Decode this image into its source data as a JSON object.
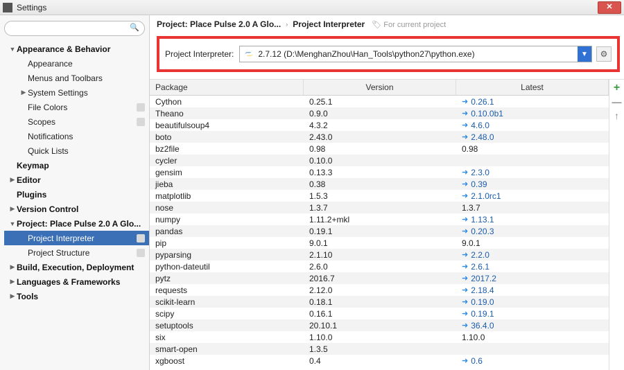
{
  "window": {
    "title": "Settings"
  },
  "sidebar": {
    "search_placeholder": "",
    "items": [
      {
        "label": "Appearance & Behavior",
        "indent": 0,
        "chev": "down",
        "bold": true
      },
      {
        "label": "Appearance",
        "indent": 1
      },
      {
        "label": "Menus and Toolbars",
        "indent": 1
      },
      {
        "label": "System Settings",
        "indent": 1,
        "chev": "right"
      },
      {
        "label": "File Colors",
        "indent": 1,
        "badge": true
      },
      {
        "label": "Scopes",
        "indent": 1,
        "badge": true
      },
      {
        "label": "Notifications",
        "indent": 1
      },
      {
        "label": "Quick Lists",
        "indent": 1
      },
      {
        "label": "Keymap",
        "indent": 0,
        "bold": true
      },
      {
        "label": "Editor",
        "indent": 0,
        "chev": "right",
        "bold": true
      },
      {
        "label": "Plugins",
        "indent": 0,
        "bold": true
      },
      {
        "label": "Version Control",
        "indent": 0,
        "chev": "right",
        "bold": true
      },
      {
        "label": "Project: Place Pulse 2.0 A Glo...",
        "indent": 0,
        "chev": "down",
        "bold": true
      },
      {
        "label": "Project Interpreter",
        "indent": 1,
        "badge": true,
        "selected": true
      },
      {
        "label": "Project Structure",
        "indent": 1,
        "badge": true
      },
      {
        "label": "Build, Execution, Deployment",
        "indent": 0,
        "chev": "right",
        "bold": true
      },
      {
        "label": "Languages & Frameworks",
        "indent": 0,
        "chev": "right",
        "bold": true
      },
      {
        "label": "Tools",
        "indent": 0,
        "chev": "right",
        "bold": true
      }
    ]
  },
  "breadcrumb": {
    "project": "Project: Place Pulse 2.0 A Glo...",
    "page": "Project Interpreter",
    "note": "For current project"
  },
  "interpreter": {
    "label": "Project Interpreter:",
    "value": "2.7.12 (D:\\MenghanZhou\\Han_Tools\\python27\\python.exe)"
  },
  "table": {
    "headers": {
      "pkg": "Package",
      "ver": "Version",
      "lat": "Latest"
    },
    "rows": [
      {
        "pkg": "Cython",
        "ver": "0.25.1",
        "lat": "0.26.1",
        "upgrade": true
      },
      {
        "pkg": "Theano",
        "ver": "0.9.0",
        "lat": "0.10.0b1",
        "upgrade": true
      },
      {
        "pkg": "beautifulsoup4",
        "ver": "4.3.2",
        "lat": "4.6.0",
        "upgrade": true
      },
      {
        "pkg": "boto",
        "ver": "2.43.0",
        "lat": "2.48.0",
        "upgrade": true
      },
      {
        "pkg": "bz2file",
        "ver": "0.98",
        "lat": "0.98",
        "upgrade": false
      },
      {
        "pkg": "cycler",
        "ver": "0.10.0",
        "lat": "",
        "upgrade": false
      },
      {
        "pkg": "gensim",
        "ver": "0.13.3",
        "lat": "2.3.0",
        "upgrade": true
      },
      {
        "pkg": "jieba",
        "ver": "0.38",
        "lat": "0.39",
        "upgrade": true
      },
      {
        "pkg": "matplotlib",
        "ver": "1.5.3",
        "lat": "2.1.0rc1",
        "upgrade": true
      },
      {
        "pkg": "nose",
        "ver": "1.3.7",
        "lat": "1.3.7",
        "upgrade": false
      },
      {
        "pkg": "numpy",
        "ver": "1.11.2+mkl",
        "lat": "1.13.1",
        "upgrade": true
      },
      {
        "pkg": "pandas",
        "ver": "0.19.1",
        "lat": "0.20.3",
        "upgrade": true
      },
      {
        "pkg": "pip",
        "ver": "9.0.1",
        "lat": "9.0.1",
        "upgrade": false
      },
      {
        "pkg": "pyparsing",
        "ver": "2.1.10",
        "lat": "2.2.0",
        "upgrade": true
      },
      {
        "pkg": "python-dateutil",
        "ver": "2.6.0",
        "lat": "2.6.1",
        "upgrade": true
      },
      {
        "pkg": "pytz",
        "ver": "2016.7",
        "lat": "2017.2",
        "upgrade": true
      },
      {
        "pkg": "requests",
        "ver": "2.12.0",
        "lat": "2.18.4",
        "upgrade": true
      },
      {
        "pkg": "scikit-learn",
        "ver": "0.18.1",
        "lat": "0.19.0",
        "upgrade": true
      },
      {
        "pkg": "scipy",
        "ver": "0.16.1",
        "lat": "0.19.1",
        "upgrade": true
      },
      {
        "pkg": "setuptools",
        "ver": "20.10.1",
        "lat": "36.4.0",
        "upgrade": true
      },
      {
        "pkg": "six",
        "ver": "1.10.0",
        "lat": "1.10.0",
        "upgrade": false
      },
      {
        "pkg": "smart-open",
        "ver": "1.3.5",
        "lat": "",
        "upgrade": false
      },
      {
        "pkg": "xgboost",
        "ver": "0.4",
        "lat": "0.6",
        "upgrade": true
      }
    ]
  },
  "icons": {
    "plus": "+",
    "minus": "—",
    "up": "↑"
  }
}
